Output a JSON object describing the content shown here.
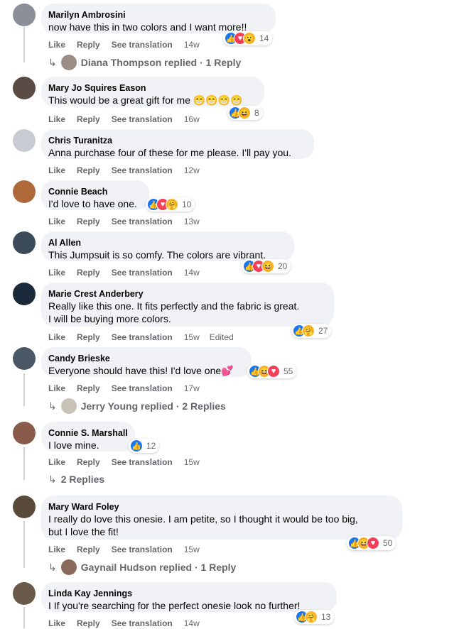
{
  "labels": {
    "like": "Like",
    "reply": "Reply",
    "see_translation": "See translation",
    "edited": "Edited"
  },
  "comments": [
    {
      "author": "Marilyn Ambrosini",
      "lines": [
        "now have this in two colors and I want more!!"
      ],
      "reactions": [
        "like",
        "love",
        "wow"
      ],
      "count": "14",
      "time": "14w",
      "replies": "Diana Thompson replied · 1 Reply",
      "avatar_color": "#8a8f9a"
    },
    {
      "author": "Mary Jo Squires Eason",
      "lines": [
        "This would be a great gift for me 😁😁😁😁"
      ],
      "reactions": [
        "like",
        "haha"
      ],
      "count": "8",
      "time": "16w",
      "avatar_color": "#5b4b45"
    },
    {
      "author": "Chris Turanitza",
      "lines": [
        "Anna purchase four of these for me please. I'll pay you."
      ],
      "reactions": [],
      "count": "",
      "time": "12w",
      "avatar_color": "#c8ccd2"
    },
    {
      "author": "Connie Beach",
      "lines": [
        "I'd love to have one."
      ],
      "reactions": [
        "like",
        "love",
        "care"
      ],
      "count": "10",
      "time": "13w",
      "avatar_color": "#b06a3a"
    },
    {
      "author": "Al Allen",
      "lines": [
        "This Jumpsuit is so comfy. The colors are vibrant."
      ],
      "reactions": [
        "like",
        "love",
        "haha"
      ],
      "count": "20",
      "time": "14w",
      "avatar_color": "#3c4b5a"
    },
    {
      "author": "Marie Crest Anderbery",
      "lines": [
        "Really like this one. It fits perfectly and the fabric is great.",
        "I will be buying more colors."
      ],
      "reactions": [
        "like",
        "care"
      ],
      "count": "27",
      "time": "15w",
      "edited": true,
      "avatar_color": "#1b2a3a"
    },
    {
      "author": "Candy Brieske",
      "lines": [
        "Everyone should have this! I'd love one💕"
      ],
      "reactions": [
        "like",
        "haha",
        "love"
      ],
      "count": "55",
      "time": "17w",
      "replies": "Jerry Young replied · 2 Replies",
      "avatar_color": "#4a5866"
    },
    {
      "author": "Connie S. Marshall",
      "lines": [
        "I love mine."
      ],
      "reactions": [
        "like"
      ],
      "count": "12",
      "time": "15w",
      "replies": "2 Replies",
      "avatar_color": "#8a5a4a"
    },
    {
      "author": "Mary Ward Foley",
      "lines": [
        "I really do love this onesie. I am petite, so I thought it would be too big,",
        "but I love the fit!"
      ],
      "reactions": [
        "like",
        "haha",
        "love"
      ],
      "count": "50",
      "time": "15w",
      "replies": "Gaynail Hudson replied · 1 Reply",
      "avatar_color": "#5a4a3a"
    },
    {
      "author": "Linda Kay Jennings",
      "lines": [
        "I If you're searching for the perfect onesie look no further!"
      ],
      "reactions": [
        "like",
        "care"
      ],
      "count": "13",
      "time": "14w",
      "avatar_color": "#6a5a4a"
    }
  ],
  "icons": {
    "like": "thumbs-up-icon",
    "love": "heart-icon",
    "wow": "wow-face-icon",
    "haha": "laughing-face-icon",
    "care": "care-face-icon",
    "reply_arrow": "reply-arrow-icon"
  },
  "colors": {
    "bubble": "#f0f2f5",
    "like_blue": "#1877f2",
    "love_red": "#f33e58",
    "gray_text": "#65676b"
  }
}
